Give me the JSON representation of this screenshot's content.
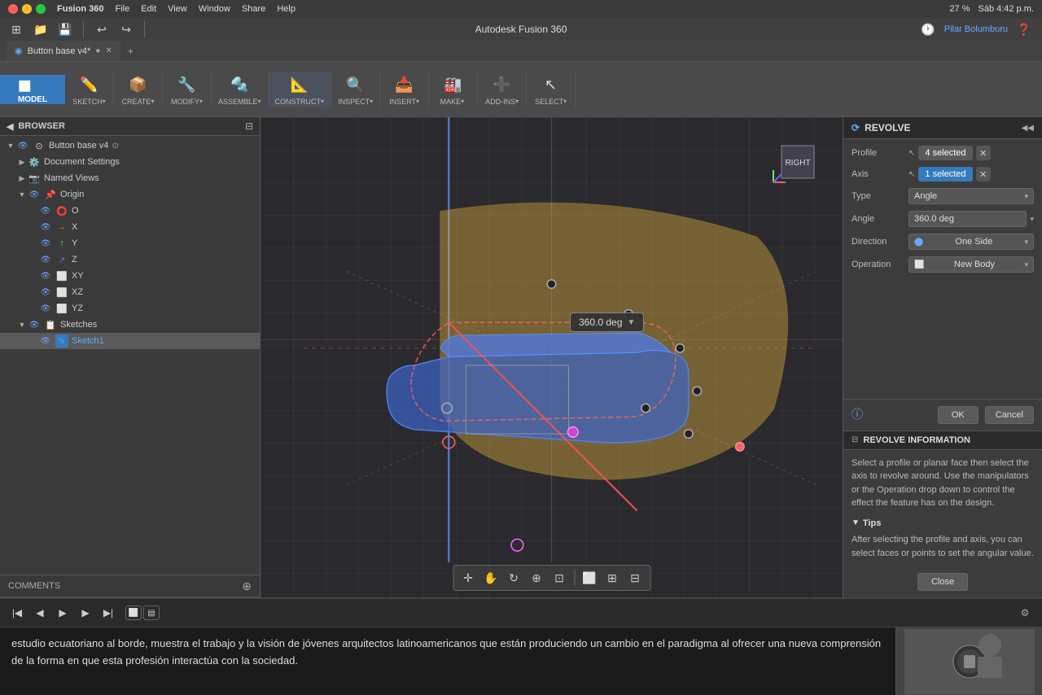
{
  "macbar": {
    "title": "Autodesk Fusion 360",
    "appname": "Fusion 360",
    "menus": [
      "File",
      "Edit",
      "View",
      "Window",
      "Share",
      "Help"
    ],
    "time": "Sáb 4:42 p.m.",
    "battery": "27 %",
    "user": "Pilar Bolumburu"
  },
  "tabs": [
    {
      "label": "Button base v4*",
      "active": true
    },
    {
      "label": "+",
      "add": true
    }
  ],
  "ribbon": {
    "mode": "MODEL",
    "groups": [
      {
        "label": "SKETCH",
        "icon": "✏️"
      },
      {
        "label": "CREATE",
        "icon": "📦"
      },
      {
        "label": "MODIFY",
        "icon": "🔧"
      },
      {
        "label": "ASSEMBLE",
        "icon": "🔩"
      },
      {
        "label": "CONSTRUCT",
        "icon": "📐"
      },
      {
        "label": "INSPECT",
        "icon": "🔍"
      },
      {
        "label": "INSERT",
        "icon": "📥"
      },
      {
        "label": "MAKE",
        "icon": "🏭"
      },
      {
        "label": "ADD-INS",
        "icon": "➕"
      },
      {
        "label": "SELECT",
        "icon": "↖️"
      }
    ]
  },
  "browser": {
    "title": "BROWSER",
    "tree": [
      {
        "label": "Button base v4",
        "icon": "📄",
        "level": 0,
        "expanded": true,
        "eye": true
      },
      {
        "label": "Document Settings",
        "icon": "⚙️",
        "level": 1,
        "expanded": false,
        "eye": false
      },
      {
        "label": "Named Views",
        "icon": "📷",
        "level": 1,
        "expanded": false,
        "eye": false
      },
      {
        "label": "Origin",
        "icon": "📌",
        "level": 1,
        "expanded": true,
        "eye": true
      },
      {
        "label": "O",
        "icon": "⭕",
        "level": 2,
        "eye": true
      },
      {
        "label": "X",
        "icon": "➡️",
        "level": 2,
        "eye": true
      },
      {
        "label": "Y",
        "icon": "⬆️",
        "level": 2,
        "eye": true
      },
      {
        "label": "Z",
        "icon": "↗️",
        "level": 2,
        "eye": true
      },
      {
        "label": "XY",
        "icon": "⬜",
        "level": 2,
        "eye": true
      },
      {
        "label": "XZ",
        "icon": "⬜",
        "level": 2,
        "eye": true
      },
      {
        "label": "YZ",
        "icon": "⬜",
        "level": 2,
        "eye": true
      },
      {
        "label": "Sketches",
        "icon": "📋",
        "level": 1,
        "expanded": true,
        "eye": true
      },
      {
        "label": "Sketch1",
        "icon": "✏️",
        "level": 2,
        "eye": true,
        "selected": true
      }
    ]
  },
  "revolve_panel": {
    "title": "REVOLVE",
    "fields": [
      {
        "label": "Profile",
        "value": "4 selected",
        "highlight": false,
        "has_x": true
      },
      {
        "label": "Axis",
        "value": "1 selected",
        "highlight": true,
        "has_x": true
      },
      {
        "label": "Type",
        "dropdown": "Angle"
      },
      {
        "label": "Angle",
        "input": "360.0 deg"
      },
      {
        "label": "Direction",
        "dropdown": "One Side"
      },
      {
        "label": "Operation",
        "dropdown": "New Body"
      }
    ],
    "ok_label": "OK",
    "cancel_label": "Cancel"
  },
  "revolve_info": {
    "title": "REVOLVE INFORMATION",
    "description": "Select a profile or planar face then select the axis to revolve around. Use the manipulators or the Operation drop down to control the effect the feature has on the design.",
    "tips_title": "Tips",
    "tips_body": "After selecting the profile and axis, you can select faces or points to set the angular value.",
    "close_label": "Close"
  },
  "viewport": {
    "angle_label": "360.0 deg"
  },
  "comments_bar": {
    "label": "COMMENTS"
  },
  "bottom_controls": {
    "play_label": "▶",
    "prev_label": "◀◀",
    "next_label": "▶▶",
    "end_label": "▶|"
  },
  "video_bar": {
    "text": "estudio ecuatoriano al borde, muestra el trabajo y la visión de jóvenes arquitectos latinoamericanos que están produciendo un cambio en el paradigma al ofrecer una nueva comprensión de la forma en que esta profesión interactúa con la sociedad."
  }
}
